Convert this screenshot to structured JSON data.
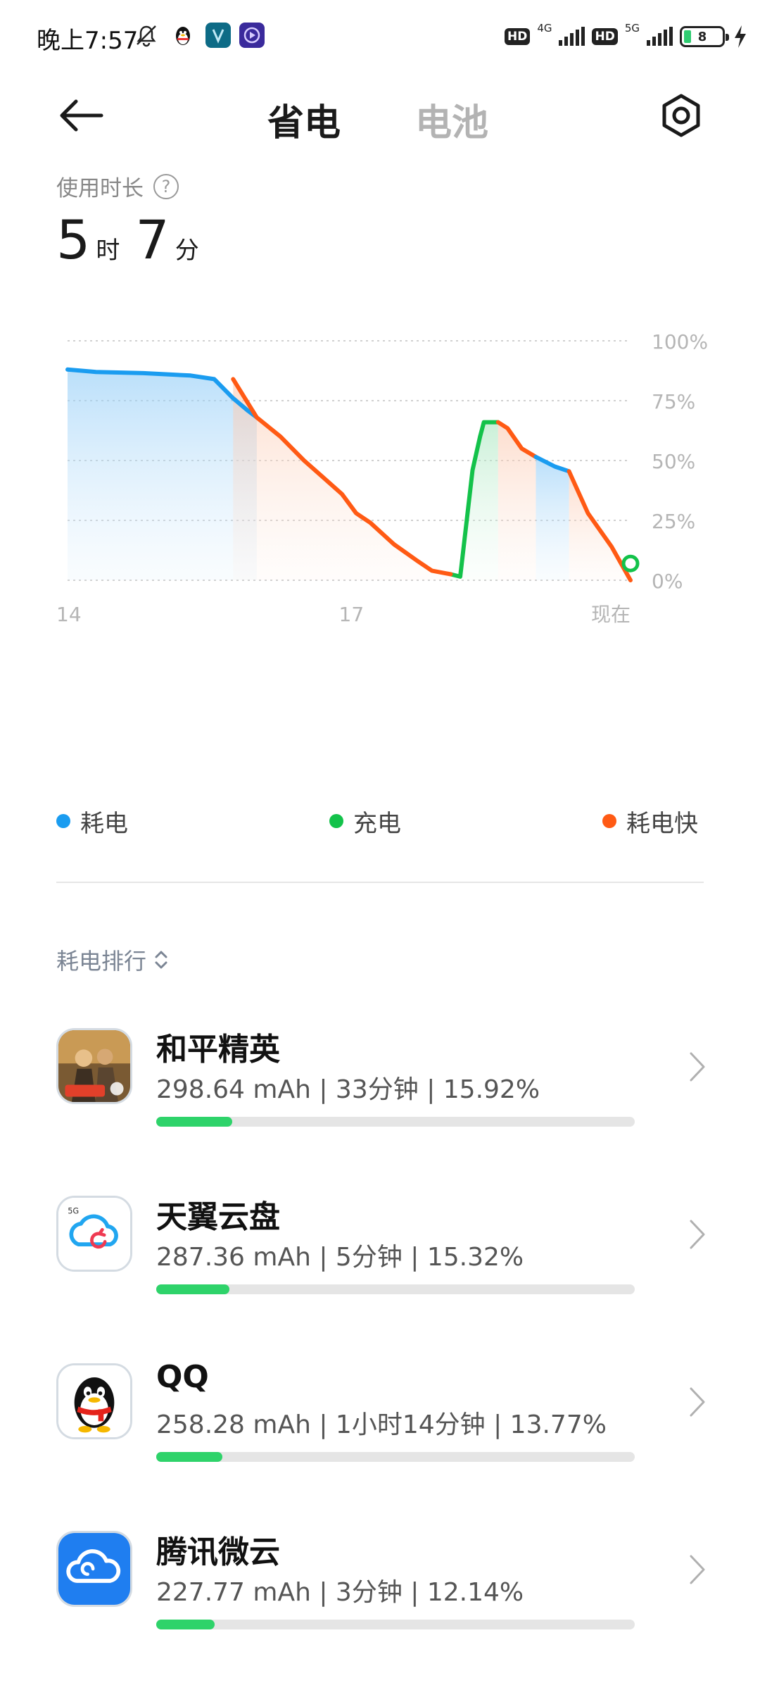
{
  "status_bar": {
    "time": "晚上7:57",
    "hd1": "HD",
    "net1": "4G",
    "hd2": "HD",
    "net2": "5G",
    "battery": "8"
  },
  "header": {
    "tab_active": "省电",
    "tab_inactive": "电池"
  },
  "usage": {
    "label": "使用时长",
    "help": "?",
    "hours": "5",
    "hours_unit": "时",
    "minutes": "7",
    "minutes_unit": "分"
  },
  "chart_data": {
    "type": "line",
    "y_tick_labels": [
      "100%",
      "75%",
      "50%",
      "25%",
      "0%"
    ],
    "x_tick_labels": [
      "14",
      "17",
      "现在"
    ],
    "ylim": [
      0,
      100
    ],
    "x_range": [
      14,
      19.95
    ],
    "grid": true,
    "legend_placement": "bottom",
    "series": [
      {
        "name": "耗电",
        "color": "#1a9cf0",
        "x": [
          14.0,
          14.3,
          14.8,
          15.3,
          15.55,
          15.75,
          15.9,
          16.0
        ],
        "y": [
          88,
          87,
          86.5,
          85.5,
          84,
          76,
          71,
          68
        ]
      },
      {
        "name": "充电",
        "color": "#13c24a",
        "x": [
          18.05,
          18.15,
          18.28,
          18.36,
          18.4,
          18.55
        ],
        "y": [
          2.5,
          1.5,
          46,
          60,
          66,
          66
        ]
      },
      {
        "name": "耗电快",
        "color": "#ff5a14",
        "x": [
          15.75,
          16.0,
          16.25,
          16.5,
          16.7,
          16.9,
          17.05,
          17.2,
          17.45,
          17.7,
          17.85,
          18.05
        ],
        "y": [
          84,
          68,
          60,
          50,
          43,
          36,
          28,
          24,
          15,
          8,
          4,
          2.5
        ]
      },
      {
        "name": "耗电快",
        "color": "#ff5a14",
        "x": [
          18.55,
          18.65,
          18.8,
          18.95
        ],
        "y": [
          66,
          63.5,
          55,
          51.5
        ]
      },
      {
        "name": "耗电",
        "color": "#1a9cf0",
        "x": [
          18.95,
          19.15,
          19.3
        ],
        "y": [
          51.5,
          47.5,
          45.5
        ]
      },
      {
        "name": "耗电快",
        "color": "#ff5a14",
        "x": [
          19.3,
          19.5,
          19.75,
          19.95
        ],
        "y": [
          45.5,
          28,
          14,
          0
        ]
      }
    ],
    "current_value": 7
  },
  "legend": {
    "item1": "耗电",
    "item2": "充电",
    "item3": "耗电快",
    "color1": "#1a9cf0",
    "color2": "#13c24a",
    "color3": "#ff5a14"
  },
  "ranking": {
    "label": "耗电排行",
    "apps": [
      {
        "name": "和平精英",
        "stats": "298.64 mAh | 33分钟 | 15.92%",
        "percent": 15.92,
        "icon": "game-icon"
      },
      {
        "name": "天翼云盘",
        "stats": "287.36 mAh | 5分钟 | 15.32%",
        "percent": 15.32,
        "icon": "cloud-sync-icon"
      },
      {
        "name": "QQ",
        "stats": "258.28 mAh | 1小时14分钟 | 13.77%",
        "percent": 13.77,
        "icon": "penguin-icon"
      },
      {
        "name": "腾讯微云",
        "stats": "227.77 mAh | 3分钟 | 12.14%",
        "percent": 12.14,
        "icon": "cloud-icon"
      }
    ]
  }
}
